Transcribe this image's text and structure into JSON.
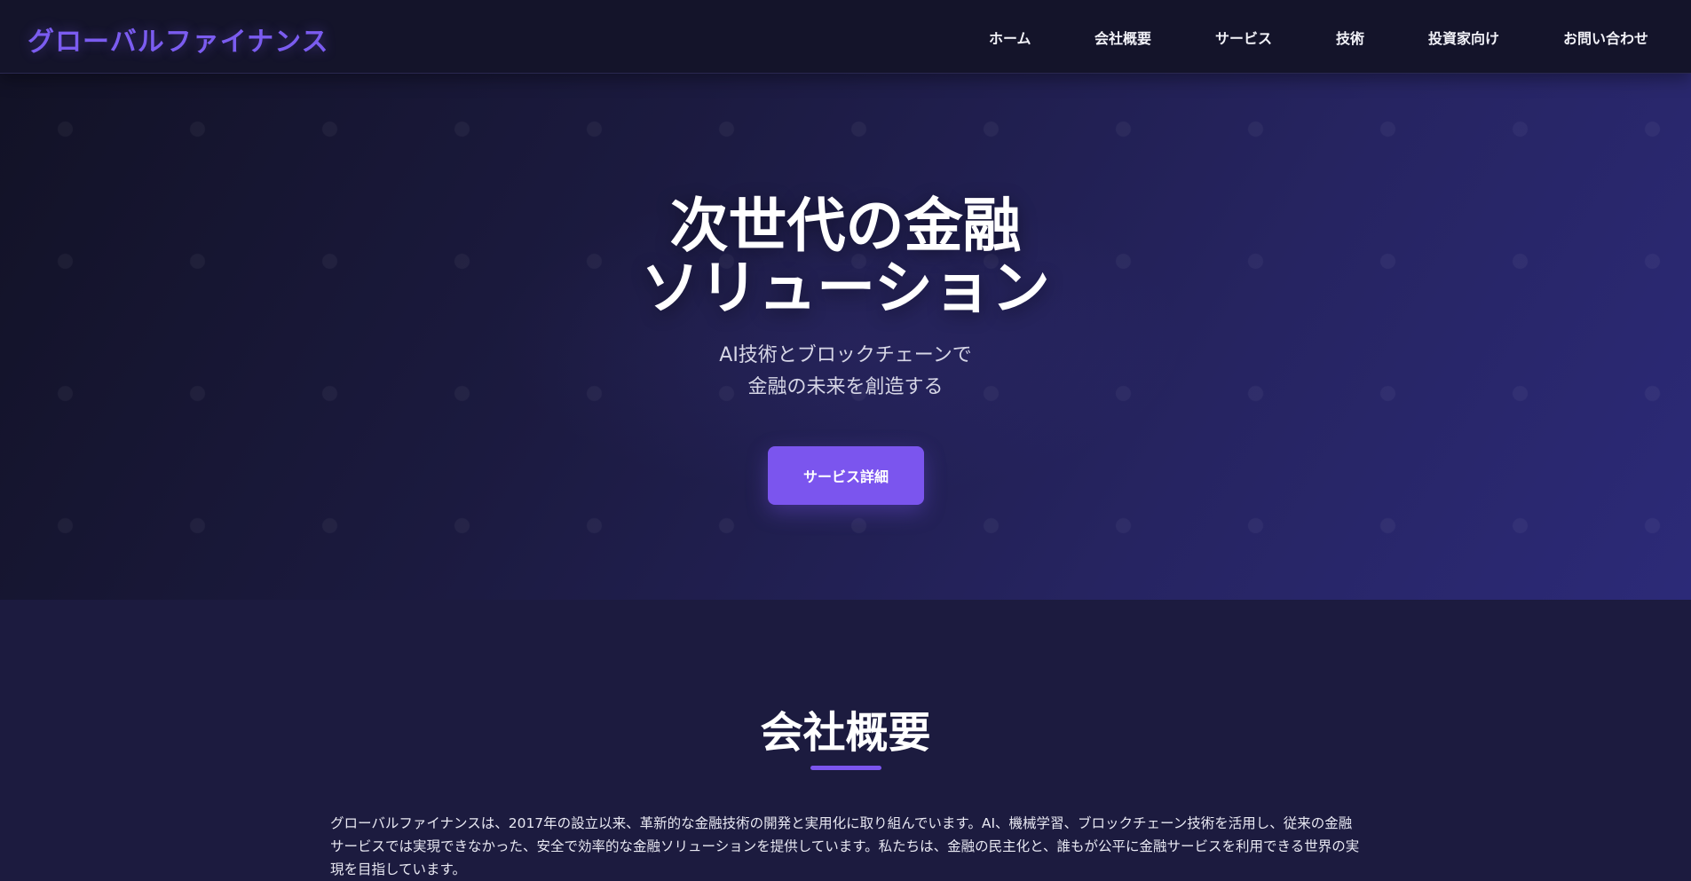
{
  "brand": {
    "logo": "グローバルファイナンス",
    "accent": "#7b55ee"
  },
  "nav": {
    "items": [
      {
        "label": "ホーム"
      },
      {
        "label": "会社概要"
      },
      {
        "label": "サービス"
      },
      {
        "label": "技術"
      },
      {
        "label": "投資家向け"
      },
      {
        "label": "お問い合わせ"
      }
    ]
  },
  "hero": {
    "title_line1": "次世代の金融",
    "title_line2": "ソリューション",
    "subtitle_line1": "AI技術とブロックチェーンで",
    "subtitle_line2": "金融の未来を創造する",
    "cta_label": "サービス詳細"
  },
  "about": {
    "title": "会社概要",
    "text": "グローバルファイナンスは、2017年の設立以来、革新的な金融技術の開発と実用化に取り組んでいます。AI、機械学習、ブロックチェーン技術を活用し、従来の金融サービスでは実現できなかった、安全で効率的な金融ソリューションを提供しています。私たちは、金融の民主化と、誰もが公平に金融サービスを利用できる世界の実現を目指しています。"
  }
}
